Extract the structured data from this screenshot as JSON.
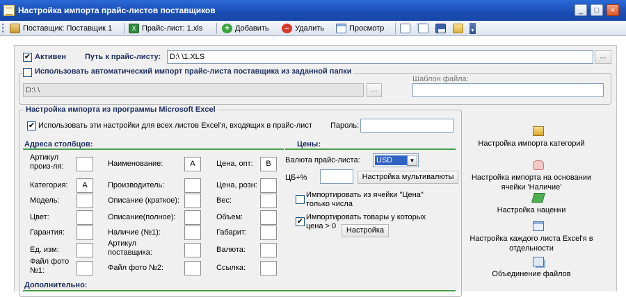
{
  "window": {
    "title": "Настройка импорта прайс-листов поставщиков"
  },
  "toolbar": {
    "supplier_label": "Поставщик: Поставщик 1",
    "pricelist_label": "Прайс-лист: 1.xls",
    "add_label": "Добавить",
    "delete_label": "Удалить",
    "preview_label": "Просмотр"
  },
  "main": {
    "active_label": "Активен",
    "path_label": "Путь к прайс-листу:",
    "path_value": "D:\\                                                                                    \\1.XLS",
    "browse_label": "...",
    "auto_import_label": "Использовать автоматический импорт прайс-листа поставщика из заданной папки",
    "folder_value": "D:\\                                                                        \\",
    "template_label": "Шаблон файла:",
    "template_value": ""
  },
  "excel": {
    "legend": "Настройка импорта из программы Microsoft Excel",
    "all_sheets_label": "Использовать эти настройки для всех листов Excel'я, входящих в прайс-лист",
    "password_label": "Пароль:",
    "password_value": "",
    "columns_title": "Адреса столбцов:",
    "col1": [
      {
        "label": "Артикул\nпроиз-ля:",
        "value": ""
      },
      {
        "label": "Категория:",
        "value": "A"
      },
      {
        "label": "Модель:",
        "value": ""
      },
      {
        "label": "Цвет:",
        "value": ""
      },
      {
        "label": "Гарантия:",
        "value": ""
      },
      {
        "label": "Ед. изм:",
        "value": ""
      },
      {
        "label": "Файл фото\n№1:",
        "value": ""
      }
    ],
    "col2": [
      {
        "label": "Наименование:",
        "value": "A"
      },
      {
        "label": "Производитель:",
        "value": ""
      },
      {
        "label": "Описание (краткое):",
        "value": ""
      },
      {
        "label": "Описание(полное):",
        "value": ""
      },
      {
        "label": "Наличие (№1):",
        "value": ""
      },
      {
        "label": "Артикул\nпоставщика:",
        "value": ""
      },
      {
        "label": "Файл фото №2:",
        "value": ""
      }
    ],
    "col3": [
      {
        "label": "Цена, опт:",
        "value": "B"
      },
      {
        "label": "Цена, розн:",
        "value": ""
      },
      {
        "label": "Вес:",
        "value": ""
      },
      {
        "label": "Объем:",
        "value": ""
      },
      {
        "label": "Габарит:",
        "value": ""
      },
      {
        "label": "Валюта:",
        "value": ""
      },
      {
        "label": "Ссылка:",
        "value": ""
      }
    ],
    "prices_title": "Цены:",
    "currency_label": "Валюта прайс-листа:",
    "currency_value": "USD",
    "cb_label": "ЦБ+%",
    "cb_value": "",
    "multicurrency_label": "Настройка мультивалюты",
    "import_numbers_label": "Импортировать из ячейки \"Цена\"\nтолько числа",
    "import_price_gt0_label": "Импортировать товары у которых\nцена > 0",
    "setup_label": "Настройка",
    "additional_title": "Дополнительно:"
  },
  "right_panel": {
    "items": [
      {
        "label": "Настройка импорта категорий",
        "icon": "folder-edit-icon"
      },
      {
        "label": "Настройка импорта на основании\nячейки 'Наличие'",
        "icon": "pointer-hand-icon"
      },
      {
        "label": "Настройка наценки",
        "icon": "money-icon"
      },
      {
        "label": "Настройка каждого листа Excel'я в\nотдельности",
        "icon": "sheet-icon"
      },
      {
        "label": "Объединение файлов",
        "icon": "merge-files-icon"
      }
    ]
  },
  "colors": {
    "title_bar": "#1b4fb8",
    "section_text": "#1e2f60",
    "green_rule": "#43a047"
  }
}
